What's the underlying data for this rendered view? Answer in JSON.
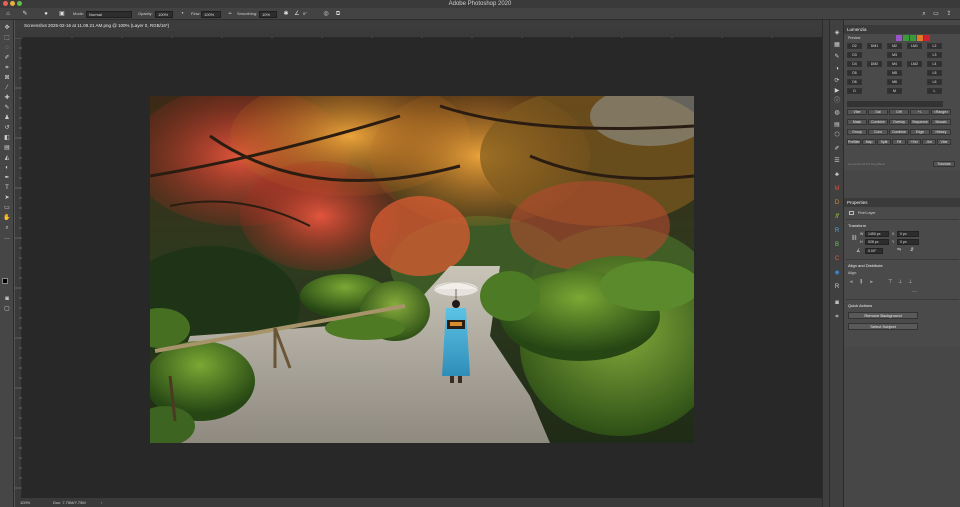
{
  "app": {
    "title": "Adobe Photoshop 2020"
  },
  "options_bar": {
    "mode_label": "Mode:",
    "mode_value": "Normal",
    "opacity_label": "Opacity:",
    "opacity_value": "100%",
    "flow_label": "Flow:",
    "flow_value": "100%",
    "smoothing_label": "Smoothing:",
    "smoothing_value": "10%",
    "angle_value": "0°"
  },
  "document": {
    "tab_title": "Screenshot 2025-02-16 at 11.09.21 AM.png @ 100% (Layer 0, RGB/16*)",
    "zoom": "100%",
    "doc_size": "Doc: 7.75M/7.75M"
  },
  "lumenzia": {
    "title": "Lumenzia",
    "preview_label": "Preview",
    "zone_labels": [
      "D2",
      "DM1",
      "M2",
      "LM1",
      "L2",
      "D3",
      "M3",
      "L3",
      "D4",
      "DM2",
      "M4",
      "LM2",
      "L4",
      "D5",
      "M5",
      "L5",
      "D6",
      "M6",
      "L6",
      "D",
      "M",
      "L"
    ],
    "button_rows": [
      [
        "Vibe",
        "Sat",
        "Diff",
        "+/-",
        "<Range>"
      ],
      [
        "Mask",
        "Combine",
        "Overlay",
        "Sequence",
        "Mosaic"
      ],
      [
        "Group",
        "Color",
        "Combine",
        "Edge",
        "History"
      ],
      [
        "PreBlend",
        "Map",
        "Split",
        "Fill",
        "+Sel",
        "-Sel",
        "Vibe"
      ]
    ],
    "footer": "Lumenzia v9.0.4 Greg Benz",
    "tutorials": "Tutorials"
  },
  "properties": {
    "title": "Properties",
    "layer_type": "Pixel Layer",
    "transform_title": "Transform",
    "w_label": "W",
    "w_value": "1450 px",
    "x_label": "X",
    "x_value": "0 px",
    "h_label": "H",
    "h_value": "928 px",
    "y_label": "Y",
    "y_value": "0 px",
    "angle_value": "0.00°",
    "align_title": "Align and Distribute",
    "align_label": "Align:",
    "quick_title": "Quick Actions",
    "remove_bg": "Remove Background",
    "select_subject": "Select Subject"
  },
  "colors": {
    "accent_red": "#d1222f",
    "swatch_purple": "#9a55c8",
    "swatch_green": "#3a9a3a",
    "swatch_orange": "#e07b24"
  }
}
